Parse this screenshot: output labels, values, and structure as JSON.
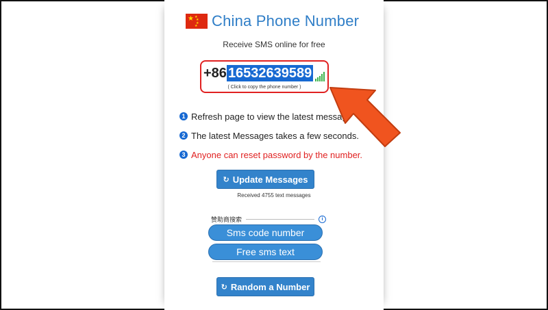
{
  "header": {
    "title": "China Phone Number",
    "subtitle": "Receive SMS online for free",
    "flag_icon": "china-flag-icon"
  },
  "phone": {
    "prefix": "+86",
    "number": "16532639589",
    "copy_hint": "( Click to copy the phone number )",
    "signal_icon": "signal-bars-icon"
  },
  "steps": [
    {
      "num": "1",
      "text": "Refresh page to view the latest messag"
    },
    {
      "num": "2",
      "text": "The latest Messages takes a few seconds."
    },
    {
      "num": "3",
      "text": "Anyone can reset password by the number."
    }
  ],
  "buttons": {
    "update": "Update Messages",
    "random": "Random a Number",
    "refresh_icon": "↻"
  },
  "received_text": "Received 4755 text messages",
  "sponsor": {
    "label": "赞助商搜索",
    "info_icon": "i",
    "links": [
      "Sms code number",
      "Free sms text"
    ]
  },
  "colors": {
    "accent": "#3383cb",
    "title": "#2f7ec7",
    "highlight": "#1769d2",
    "warning": "#e02020",
    "signal": "#3cb34a",
    "arrow": "#f0541f"
  }
}
